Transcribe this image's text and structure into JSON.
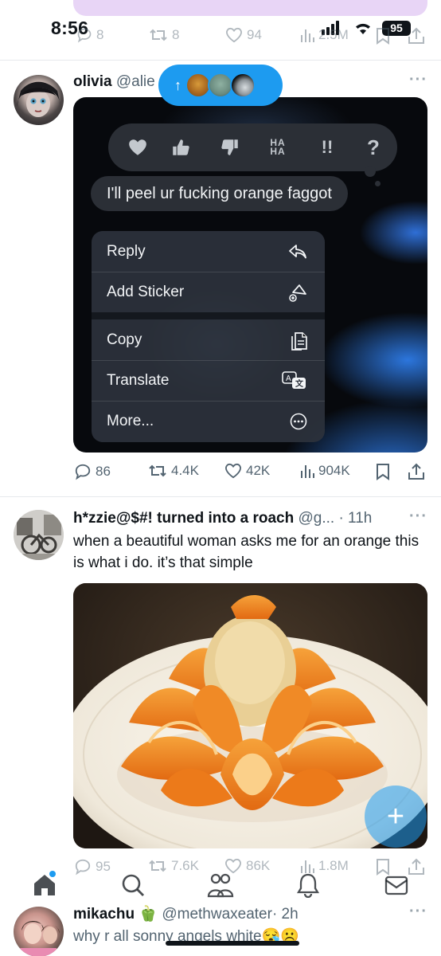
{
  "status_bar": {
    "time": "8:56",
    "battery": "95"
  },
  "top_tweet_actions": {
    "replies": "8",
    "reposts": "8",
    "likes": "94",
    "views": "2.5M"
  },
  "post1": {
    "display_name": "olivia",
    "handle": "@alie",
    "new_posts_pill": {
      "arrow": "↑"
    },
    "reactions": [
      "heart",
      "thumbs-up",
      "thumbs-down",
      "HA HA",
      "!!",
      "?"
    ],
    "message": "I'll peel ur fucking orange faggot",
    "menu": [
      {
        "label": "Reply",
        "icon": "reply-icon"
      },
      {
        "label": "Add Sticker",
        "icon": "sticker-icon"
      },
      {
        "label": "Copy",
        "icon": "copy-icon"
      },
      {
        "label": "Translate",
        "icon": "translate-icon"
      },
      {
        "label": "More...",
        "icon": "more-icon"
      }
    ],
    "actions": {
      "replies": "86",
      "reposts": "4.4K",
      "likes": "42K",
      "views": "904K"
    }
  },
  "post2": {
    "display_name": "h*zzie@$#! turned into a roach",
    "handle": "@g...",
    "time": "· 11h",
    "text": "when a beautiful woman asks me for an orange this is what i do. it’s that simple",
    "actions": {
      "replies": "95",
      "reposts": "7.6K",
      "likes": "86K",
      "views": "1.8M"
    }
  },
  "post3": {
    "display_name": "mikachu",
    "emoji": "🫑",
    "handle": "@methwaxeater",
    "time": "· 2h",
    "text": "why r all sonny angels white😪☹️"
  },
  "colors": {
    "accent": "#1d9bf0",
    "text": "#0f1419",
    "muted": "#536471"
  }
}
